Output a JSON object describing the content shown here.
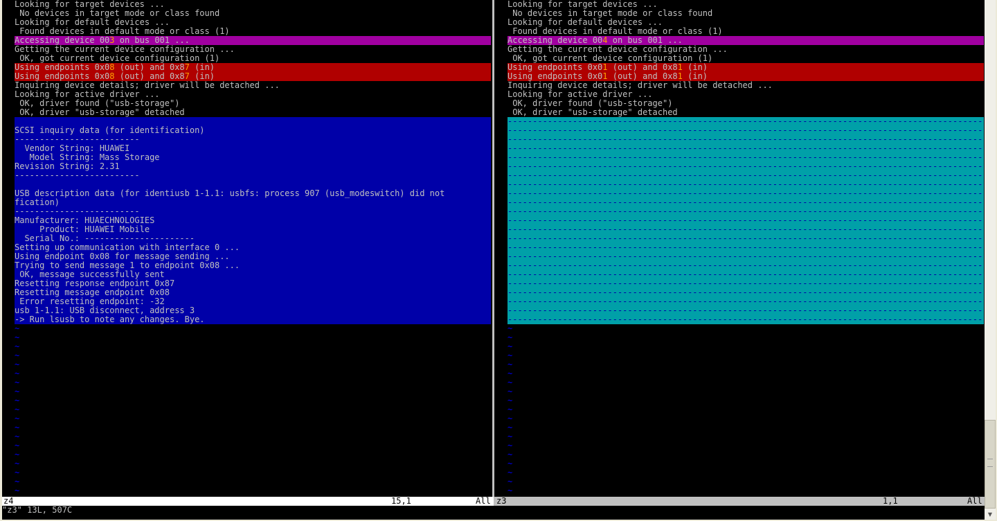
{
  "left_pane": {
    "lines": [
      {
        "text": "Looking for target devices ...",
        "style": ""
      },
      {
        "text": " No devices in target mode or class found",
        "style": ""
      },
      {
        "text": "Looking for default devices ...",
        "style": ""
      },
      {
        "text": " Found devices in default mode or class (1)",
        "style": ""
      },
      {
        "pre": "Accessing device 00",
        "diff": "3",
        "post": " on bus 001 ...",
        "style": "mag"
      },
      {
        "text": "Getting the current device configuration ...",
        "style": ""
      },
      {
        "text": " OK, got current device configuration (1)",
        "style": ""
      },
      {
        "pre": "Using endpoints 0x0",
        "diff": "8",
        "post": " (out) and 0x8",
        "diff2": "7",
        "post2": " (in)",
        "style": "red"
      },
      {
        "pre": "Using endpoints 0x0",
        "diff": "8",
        "post": " (out) and 0x8",
        "diff2": "7",
        "post2": " (in)",
        "style": "red"
      },
      {
        "text": "Inquiring device details; driver will be detached ...",
        "style": ""
      },
      {
        "text": "Looking for active driver ...",
        "style": ""
      },
      {
        "text": " OK, driver found (\"usb-storage\")",
        "style": ""
      },
      {
        "text": " OK, driver \"usb-storage\" detached",
        "style": ""
      },
      {
        "text": "",
        "style": "blue"
      },
      {
        "text": "SCSI inquiry data (for identification)",
        "style": "blue"
      },
      {
        "text": "-------------------------",
        "style": "blue"
      },
      {
        "text": "  Vendor String: HUAWEI",
        "style": "blue"
      },
      {
        "text": "   Model String: Mass Storage",
        "style": "blue"
      },
      {
        "text": "Revision String: 2.31",
        "style": "blue"
      },
      {
        "text": "-------------------------",
        "style": "blue"
      },
      {
        "text": "",
        "style": "blue"
      },
      {
        "text": "USB description data (for identiusb 1-1.1: usbfs: process 907 (usb_modeswitch) did not",
        "style": "blue"
      },
      {
        "text": "fication)",
        "style": "blue"
      },
      {
        "text": "-------------------------",
        "style": "blue"
      },
      {
        "text": "Manufacturer: HUAECHNOLOGIES",
        "style": "blue"
      },
      {
        "text": "     Product: HUAWEI Mobile",
        "style": "blue"
      },
      {
        "text": "  Serial No.: ----------------------",
        "style": "blue"
      },
      {
        "text": "Setting up communication with interface 0 ...",
        "style": "blue"
      },
      {
        "text": "Using endpoint 0x08 for message sending ...",
        "style": "blue"
      },
      {
        "text": "Trying to send message 1 to endpoint 0x08 ...",
        "style": "blue"
      },
      {
        "text": " OK, message successfully sent",
        "style": "blue"
      },
      {
        "text": "Resetting response endpoint 0x87",
        "style": "blue"
      },
      {
        "text": "Resetting message endpoint 0x08",
        "style": "blue"
      },
      {
        "text": " Error resetting endpoint: -32",
        "style": "blue"
      },
      {
        "text": "usb 1-1.1: USB disconnect, address 3",
        "style": "blue"
      },
      {
        "text": "-> Run lsusb to note any changes. Bye.",
        "style": "blue"
      }
    ]
  },
  "right_pane": {
    "lines": [
      {
        "text": "Looking for target devices ...",
        "style": ""
      },
      {
        "text": " No devices in target mode or class found",
        "style": ""
      },
      {
        "text": "Looking for default devices ...",
        "style": ""
      },
      {
        "text": " Found devices in default mode or class (1)",
        "style": ""
      },
      {
        "pre": "Accessing device 00",
        "diff": "4",
        "post": " on bus 001 ...",
        "style": "mag"
      },
      {
        "text": "Getting the current device configuration ...",
        "style": ""
      },
      {
        "text": " OK, got current device configuration (1)",
        "style": ""
      },
      {
        "pre": "Using endpoints 0x0",
        "diff": "1",
        "post": " (out) and 0x8",
        "diff2": "1",
        "post2": " (in)",
        "style": "red"
      },
      {
        "pre": "Using endpoints 0x0",
        "diff": "1",
        "post": " (out) and 0x8",
        "diff2": "1",
        "post2": " (in)",
        "style": "red"
      },
      {
        "text": "Inquiring device details; driver will be detached ...",
        "style": ""
      },
      {
        "text": "Looking for active driver ...",
        "style": ""
      },
      {
        "text": " OK, driver found (\"usb-storage\")",
        "style": ""
      },
      {
        "text": " OK, driver \"usb-storage\" detached",
        "style": ""
      }
    ],
    "filler_count": 23,
    "filler_char": "-"
  },
  "tilde_count": 19,
  "tilde_char": "~",
  "status": {
    "left": {
      "name": "z4",
      "position": "15,1",
      "scroll": "All"
    },
    "right": {
      "name": "z3",
      "position": "1,1",
      "scroll": "All"
    }
  },
  "cmdline": {
    "text": "\"z3\" 13L, 507C"
  },
  "colors": {
    "magenta": "#a000a0",
    "red": "#b00000",
    "blue": "#0000a8",
    "cyan": "#00a0a8",
    "diff_char": "#ffa000",
    "tilde": "#0000ff"
  }
}
